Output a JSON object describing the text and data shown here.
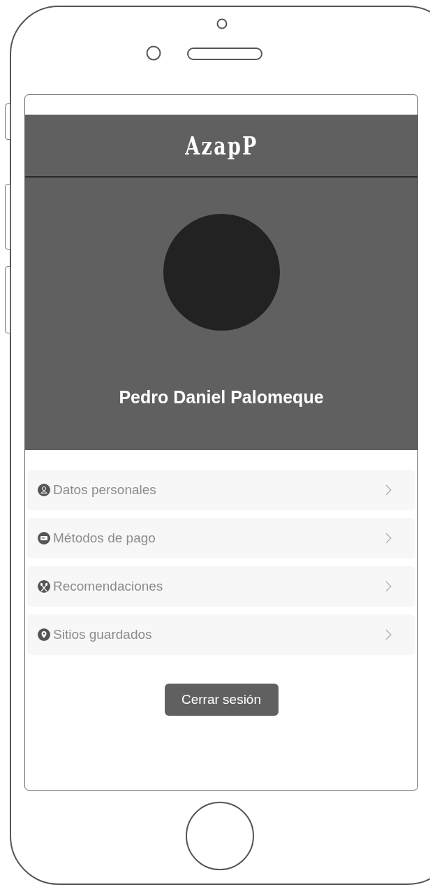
{
  "app_bar": {
    "title": "AzapP"
  },
  "profile": {
    "name": "Pedro Daniel Palomeque"
  },
  "menu": [
    {
      "kind": "user",
      "label": "Datos personales"
    },
    {
      "kind": "card",
      "label": "Métodos de pago"
    },
    {
      "kind": "cutlery",
      "label": "Recomendaciones"
    },
    {
      "kind": "pin",
      "label": "Sitios guardados"
    }
  ],
  "logout_button": "Cerrar sesión"
}
